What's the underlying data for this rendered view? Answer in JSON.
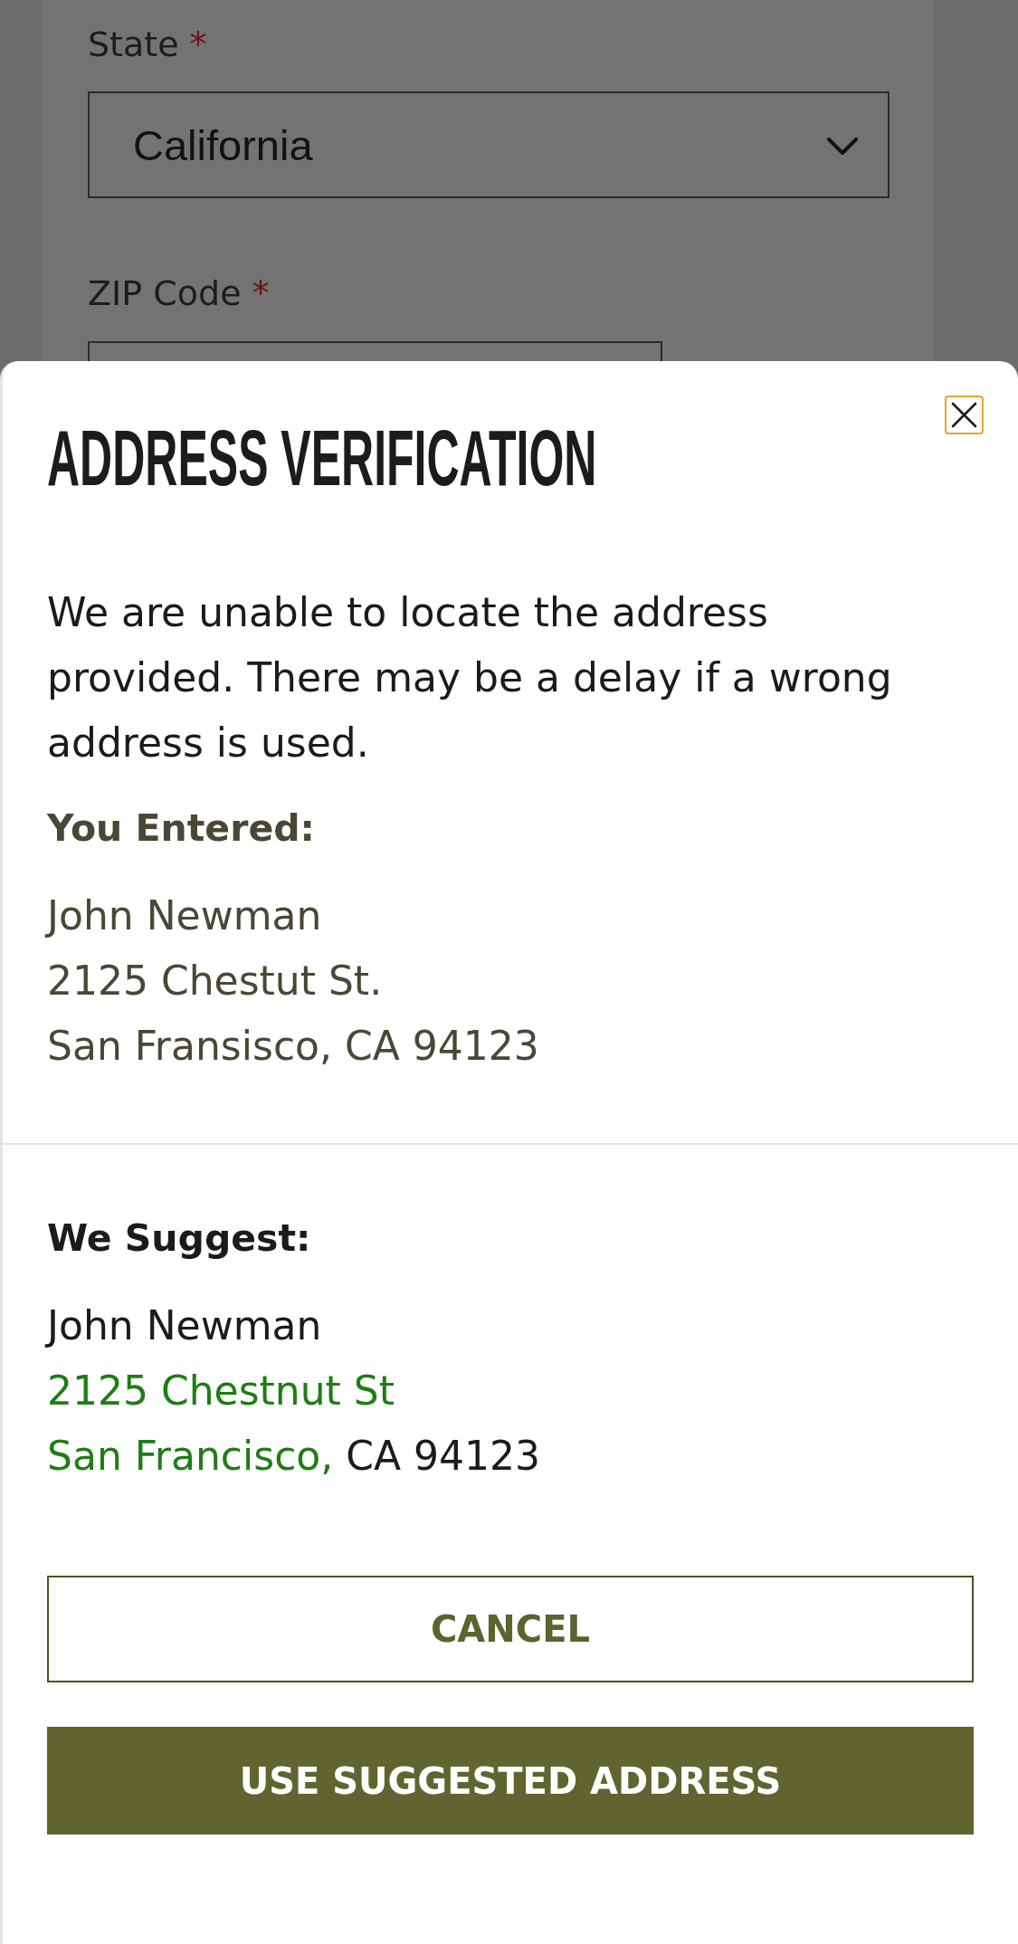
{
  "background_form": {
    "fields": [
      {
        "kind": "select",
        "label": "State",
        "required_mark": "*",
        "value": "California"
      },
      {
        "kind": "text",
        "label": "ZIP Code",
        "required_mark": "*"
      }
    ]
  },
  "dialog": {
    "title": "ADDRESS VERIFICATION",
    "close_button": {
      "focused": true
    },
    "message": "We are unable to locate the address provided. There may be a delay if a wrong address is used.",
    "entered": {
      "heading": "You Entered:",
      "lines": [
        "John Newman",
        "2125 Chestut St.",
        "San Fransisco, CA 94123"
      ]
    },
    "suggested": {
      "heading": "We Suggest:",
      "lines": [
        {
          "segments": [
            {
              "text": "John Newman",
              "changed": false
            }
          ]
        },
        {
          "segments": [
            {
              "text": "2125 Chestnut St",
              "changed": true
            }
          ]
        },
        {
          "segments": [
            {
              "text": "San Francisco,",
              "changed": true
            },
            {
              "text": "CA 94123",
              "changed": false
            }
          ]
        }
      ]
    },
    "buttons": [
      {
        "kind": "outline",
        "label": "CANCEL"
      },
      {
        "kind": "filled",
        "label": "USE SUGGESTED ADDRESS"
      }
    ]
  }
}
